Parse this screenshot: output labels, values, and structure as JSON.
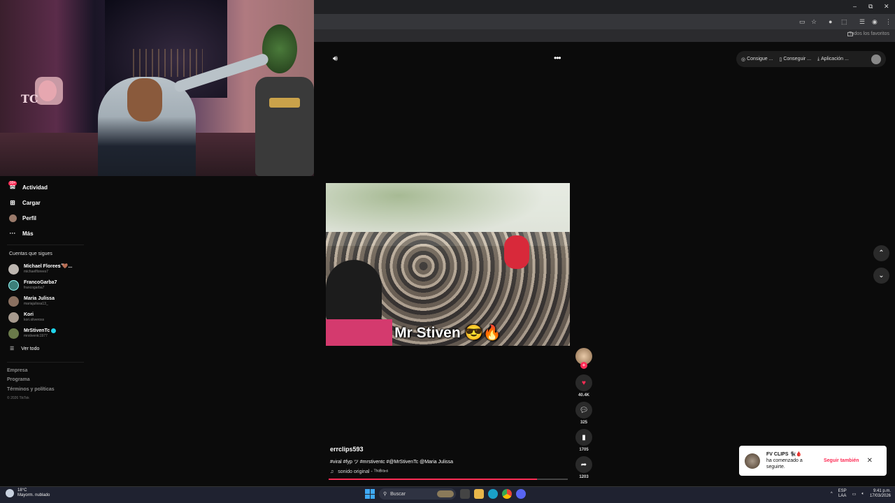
{
  "browser": {
    "bookmarks_label": "Todos los favoritos"
  },
  "sidebar": {
    "activity_badge": "99+",
    "nav": [
      {
        "label": "Actividad",
        "icon": "activity-icon"
      },
      {
        "label": "Cargar",
        "icon": "upload-icon"
      },
      {
        "label": "Perfil",
        "icon": "profile-icon"
      },
      {
        "label": "Más",
        "icon": "more-icon"
      }
    ],
    "following_title": "Cuentas que sigues",
    "following": [
      {
        "name": "Michael Floreesُ 🤎...",
        "handle": "michaelflorees7"
      },
      {
        "name": "FrancoGarba7",
        "handle": "francogarba7"
      },
      {
        "name": "Maria Julissa",
        "handle": "mariajulissa13_"
      },
      {
        "name": "Kori",
        "handle": "kori.oliveross"
      },
      {
        "name": "MrStivenTc",
        "handle": "mrstiventc1977"
      }
    ],
    "see_all": "Ver todo",
    "footer": [
      "Empresa",
      "Programa",
      "Términos y políticas"
    ],
    "copyright": "© 2026 TikTok"
  },
  "topbar": {
    "buttons": [
      "Consigue ...",
      "Conseguir ...",
      "Aplicación ..."
    ]
  },
  "video": {
    "caption": "Mr Stiven 😎🔥",
    "username": "errclips593",
    "description": "#viral #fyp ツ #mrstiventc #@MrStivenTc @Maria Julissa",
    "sound": "sonido original - ᵀʰᵉᴮʳᵃⁿˢ",
    "progress_fraction": 0.87
  },
  "actions": {
    "likes": "40.4K",
    "comments": "325",
    "saves": "1705",
    "shares": "1203"
  },
  "toast": {
    "name": "FV CLIPS 🐈‍⬛🩸",
    "message": "ha comenzado a seguirte.",
    "follow_label": "Seguir también"
  },
  "taskbar": {
    "temperature": "18°C",
    "weather": "Mayorm. nublado",
    "search_placeholder": "Buscar",
    "lang_1": "ESP",
    "lang_2": "LAA",
    "time": "9:41 p.m.",
    "date": "17/03/2026"
  },
  "colors": {
    "accent": "#fe2c55",
    "background": "#0b0b0b"
  }
}
